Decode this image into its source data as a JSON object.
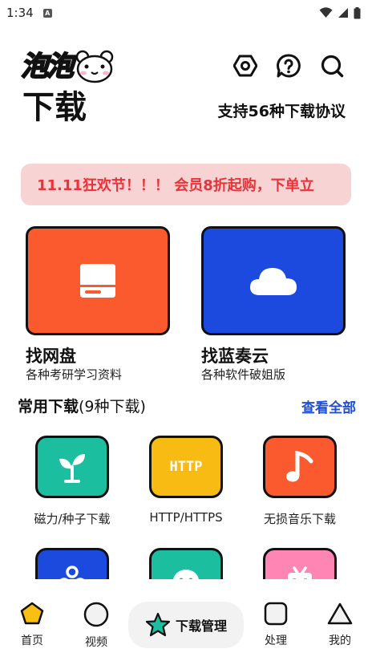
{
  "status_bar": {
    "time": "1:34",
    "app_icon_letter": "A"
  },
  "header": {
    "brand": "泡泡",
    "title": "下载",
    "protocols_text": "支持56种下载协议",
    "actions": [
      {
        "icon": "settings-hex-icon"
      },
      {
        "icon": "help-chat-icon"
      },
      {
        "icon": "search-icon"
      }
    ]
  },
  "promo": {
    "text": "11.11狂欢节！！！ 会员8折起购，下单立"
  },
  "features": [
    {
      "title": "找网盘",
      "subtitle": "各种考研学习资料",
      "icon": "hard-drive-icon",
      "color": "#fb5a2e"
    },
    {
      "title": "找蓝奏云",
      "subtitle": "各种软件破姐版",
      "icon": "cloud-icon",
      "color": "#1c4ade"
    }
  ],
  "section": {
    "title_bold": "常用下载",
    "title_count": "(9种下载)",
    "view_all": "查看全部"
  },
  "tools": [
    {
      "label": "磁力/种子下载",
      "icon": "sprout-icon",
      "color": "#1bbf9f"
    },
    {
      "label": "HTTP/HTTPS",
      "icon": "http-icon",
      "icon_text": "HTTP",
      "color": "#f7bb14"
    },
    {
      "label": "无损音乐下载",
      "icon": "music-note-icon",
      "color": "#fb5a2e"
    },
    {
      "label": "",
      "icon": "share-icon",
      "color": "#1c4ade"
    },
    {
      "label": "",
      "icon": "chat-bubble-icon",
      "color": "#1bbf9f"
    },
    {
      "label": "",
      "icon": "tv-icon",
      "color": "#ff85b5"
    }
  ],
  "tab_bar": {
    "items": [
      {
        "label": "首页",
        "icon": "pentagon-icon",
        "active": true
      },
      {
        "label": "视频",
        "icon": "circle-icon"
      },
      {
        "label": "下载管理",
        "icon": "star-icon",
        "center": true
      },
      {
        "label": "处理",
        "icon": "square-icon"
      },
      {
        "label": "我的",
        "icon": "triangle-icon"
      }
    ]
  },
  "colors": {
    "accent_blue": "#1f4fd6",
    "promo_bg": "#f8d3d3",
    "promo_text": "#e8333a",
    "home_active": "#f7c012",
    "star": "#1bbf9f"
  }
}
